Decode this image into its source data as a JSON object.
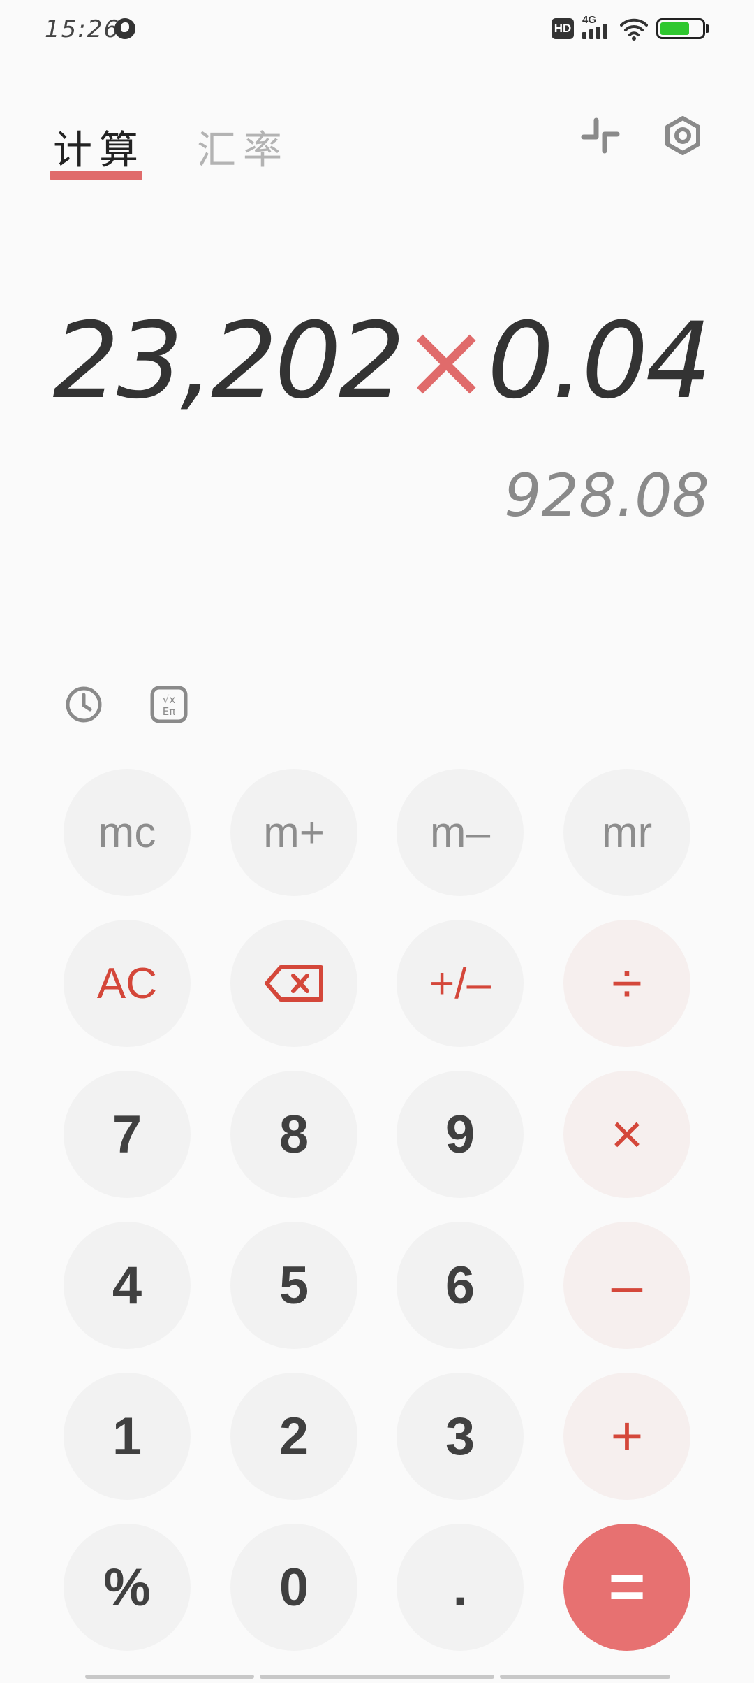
{
  "status_bar": {
    "time": "15:26",
    "network_label": "4G",
    "hd_label": "HD",
    "battery_level": 0.7,
    "icons": [
      "globe-icon",
      "hd-icon",
      "signal-icon",
      "wifi-icon",
      "battery-icon"
    ]
  },
  "tabs": {
    "calculate": "计算",
    "exchange": "汇率"
  },
  "toolbar_icons": [
    "collapse-icon",
    "settings-icon"
  ],
  "display": {
    "operand_1": "23,202",
    "operator": "×",
    "operand_2": "0.04",
    "result": "928.08"
  },
  "tools": [
    "history-icon",
    "scientific-icon"
  ],
  "keys": {
    "mc": "mc",
    "mplus": "m+",
    "mminus": "m–",
    "mr": "mr",
    "ac": "AC",
    "sign": "+/–",
    "divide": "÷",
    "seven": "7",
    "eight": "8",
    "nine": "9",
    "multiply": "×",
    "four": "4",
    "five": "5",
    "six": "6",
    "subtract": "–",
    "one": "1",
    "two": "2",
    "three": "3",
    "add": "+",
    "percent": "%",
    "zero": "0",
    "dot": ".",
    "equals": "="
  },
  "colors": {
    "accent": "#e06b6b",
    "operator_text": "#d4473a",
    "equals_bg": "#e77171",
    "key_bg": "#f2f2f2"
  }
}
